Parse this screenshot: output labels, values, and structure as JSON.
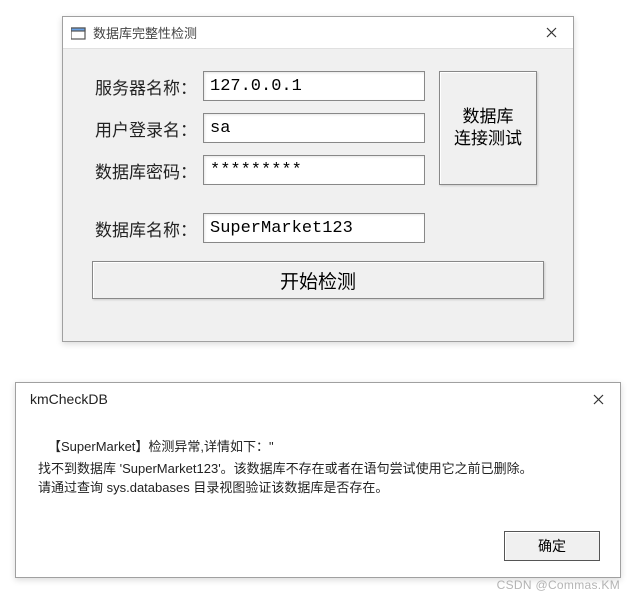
{
  "main_window": {
    "title": "数据库完整性检测",
    "fields": {
      "server_label": "服务器名称：",
      "server_value": "127.0.0.1",
      "user_label": "用户登录名：",
      "user_value": "sa",
      "password_label": "数据库密码：",
      "password_value": "*********",
      "dbname_label": "数据库名称：",
      "dbname_value": "SuperMarket123"
    },
    "buttons": {
      "test_connection": "数据库\n连接测试",
      "start_check": "开始检测"
    }
  },
  "dialog": {
    "title": "kmCheckDB",
    "message_line1": "【SuperMarket】检测异常,详情如下：\"",
    "message_line2": "找不到数据库 'SuperMarket123'。该数据库不存在或者在语句尝试使用它之前已删除。",
    "message_line3": "请通过查询 sys.databases 目录视图验证该数据库是否存在。",
    "ok_button": "确定"
  },
  "watermark": "CSDN @Commas.KM"
}
